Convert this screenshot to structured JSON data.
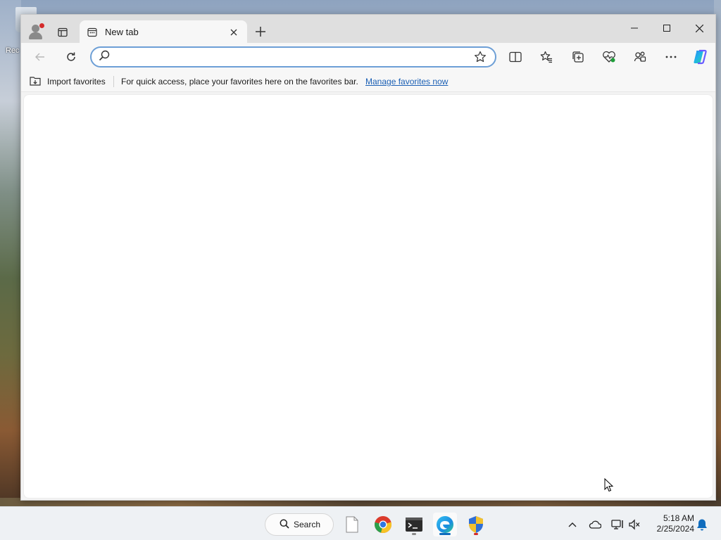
{
  "desktop": {
    "recycle_label": "Rec"
  },
  "browser": {
    "tab": {
      "title": "New tab"
    },
    "address": {
      "value": "",
      "placeholder": ""
    },
    "favorites_bar": {
      "import_label": "Import favorites",
      "message": "For quick access, place your favorites here on the favorites bar.",
      "manage_link": "Manage favorites now"
    },
    "icons": [
      "profile-icon",
      "tab-actions-icon",
      "tab-favicon",
      "close-tab-icon",
      "new-tab-icon",
      "minimize-icon",
      "maximize-icon",
      "close-window-icon",
      "back-icon",
      "refresh-icon",
      "search-icon",
      "favorite-star-icon",
      "split-screen-icon",
      "favorites-icon",
      "collections-icon",
      "browser-essentials-icon",
      "workspaces-icon",
      "more-icon",
      "copilot-icon"
    ]
  },
  "taskbar": {
    "search_label": "Search",
    "apps": [
      "file-icon",
      "chrome-icon",
      "terminal-icon",
      "edge-icon",
      "security-shield-icon"
    ],
    "clock": {
      "time": "5:18 AM",
      "date": "2/25/2024"
    }
  },
  "colors": {
    "accent": "#1a5fb4",
    "edge_blue": "#0f6cbd",
    "notification_dot": "#d42a2a"
  }
}
